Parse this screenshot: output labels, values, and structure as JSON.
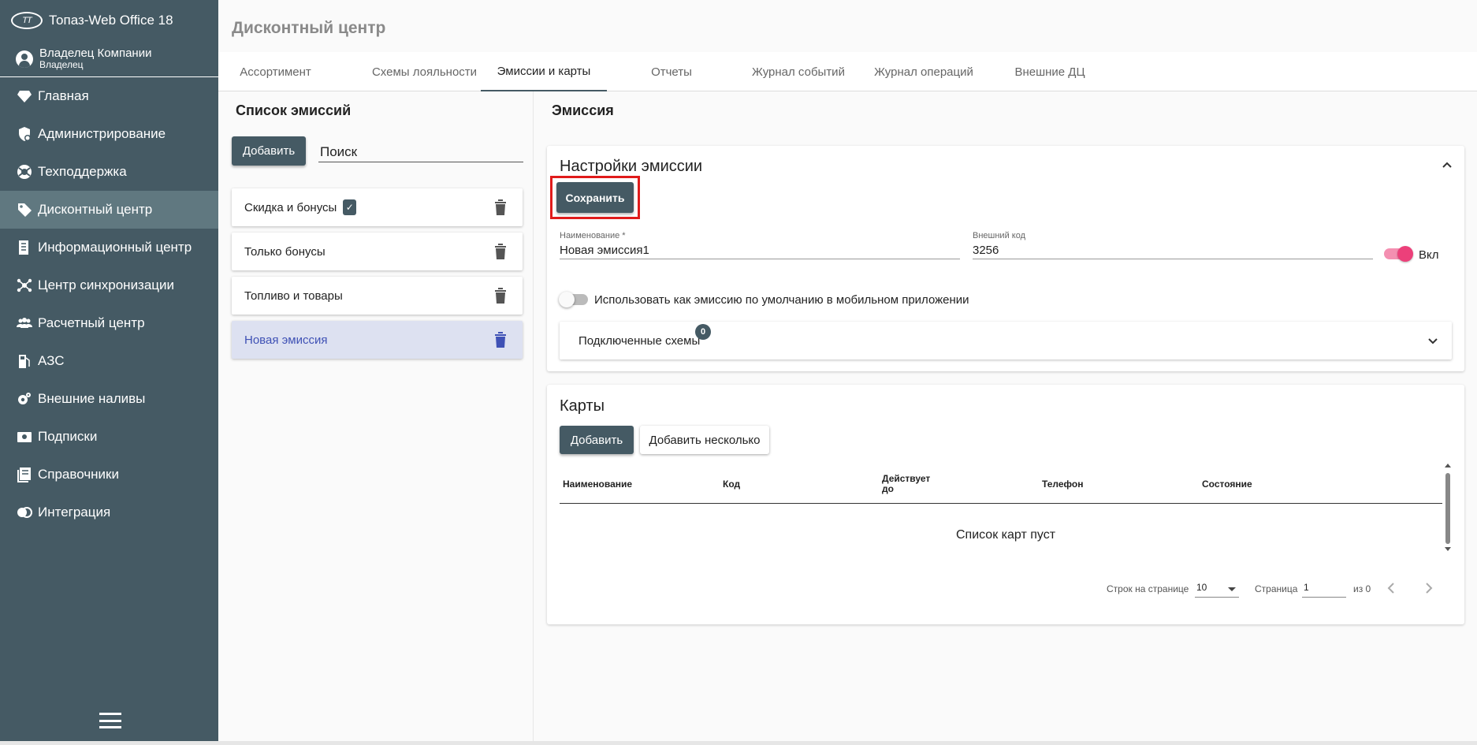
{
  "app": {
    "title": "Топаз-Web Office 18",
    "logo_text": "TT"
  },
  "user": {
    "name": "Владелец Компании",
    "role": "Владелец"
  },
  "sidebar": {
    "items": [
      {
        "label": "Главная",
        "icon": "diamond-icon"
      },
      {
        "label": "Администрирование",
        "icon": "admin-shield-icon"
      },
      {
        "label": "Техподдержка",
        "icon": "lifebuoy-icon"
      },
      {
        "label": "Дисконтный центр",
        "icon": "tag-icon",
        "active": true
      },
      {
        "label": "Информационный центр",
        "icon": "document-icon"
      },
      {
        "label": "Центр синхронизации",
        "icon": "hub-icon"
      },
      {
        "label": "Расчетный центр",
        "icon": "people-icon"
      },
      {
        "label": "АЗС",
        "icon": "fuel-icon"
      },
      {
        "label": "Внешние наливы",
        "icon": "gear-icon"
      },
      {
        "label": "Подписки",
        "icon": "subscription-icon"
      },
      {
        "label": "Справочники",
        "icon": "book-icon"
      },
      {
        "label": "Интеграция",
        "icon": "integration-icon"
      }
    ]
  },
  "page": {
    "title": "Дисконтный центр"
  },
  "tabs": [
    {
      "label": "Ассортимент"
    },
    {
      "label": "Схемы лояльности"
    },
    {
      "label": "Эмиссии и карты",
      "active": true
    },
    {
      "label": "Отчеты"
    },
    {
      "label": "Журнал событий"
    },
    {
      "label": "Журнал операций"
    },
    {
      "label": "Внешние ДЦ"
    }
  ],
  "emissions": {
    "title": "Список эмиссий",
    "add_label": "Добавить",
    "search_placeholder": "Поиск",
    "items": [
      {
        "label": "Скидка и бонусы",
        "has_badge": true
      },
      {
        "label": "Только бонусы"
      },
      {
        "label": "Топливо и товары"
      },
      {
        "label": "Новая эмиссия",
        "selected": true
      }
    ]
  },
  "emission": {
    "title": "Эмиссия",
    "settings_title": "Настройки эмиссии",
    "save_label": "Сохранить",
    "name_label": "Наименование *",
    "name_value": "Новая эмиссия1",
    "code_label": "Внешний код",
    "code_value": "3256",
    "enabled_label": "Вкл",
    "default_mobile_label": "Использовать как эмиссию по умолчанию в мобильном приложении",
    "schemes_label": "Подключенные схемы",
    "schemes_count": "0"
  },
  "cards": {
    "title": "Карты",
    "add_label": "Добавить",
    "add_many_label": "Добавить несколько",
    "columns": [
      "Наименование",
      "Код",
      "Действует до",
      "Телефон",
      "Состояние"
    ],
    "empty_text": "Список карт пуст",
    "rows_per_page_label": "Строк на странице",
    "rows_per_page_value": "10",
    "page_label": "Страница",
    "page_value": "1",
    "of_label": "из 0"
  },
  "colors": {
    "accent": "#455a64",
    "toggle": "#ec407a",
    "selected": "#3f51b5",
    "highlight": "#e01b1b"
  }
}
